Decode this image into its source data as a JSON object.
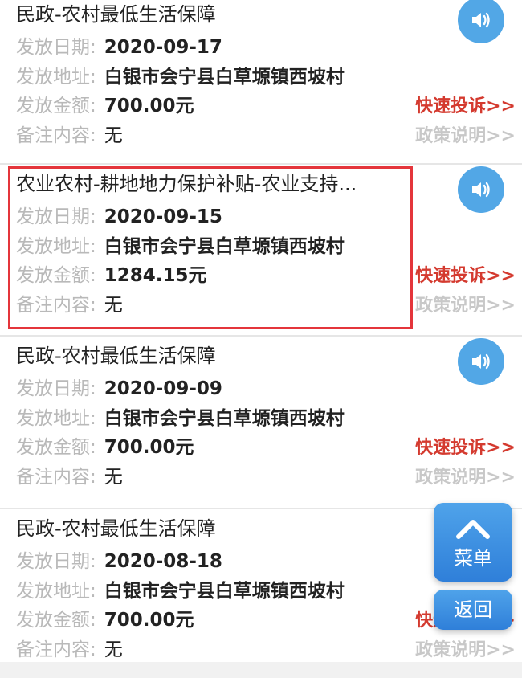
{
  "labels": {
    "date": "发放日期:",
    "address": "发放地址:",
    "amount": "发放金额:",
    "remark": "备注内容:"
  },
  "actions": {
    "complain": "快速投诉>>",
    "policy": "政策说明>>"
  },
  "records": [
    {
      "title": "民政-农村最低生活保障",
      "date": "2020-09-17",
      "address": "白银市会宁县白草塬镇西坡村",
      "amount": "700.00元",
      "remark": "无"
    },
    {
      "title": "农业农村-耕地地力保护补贴-农业支持...",
      "date": "2020-09-15",
      "address": "白银市会宁县白草塬镇西坡村",
      "amount": "1284.15元",
      "remark": "无"
    },
    {
      "title": "民政-农村最低生活保障",
      "date": "2020-09-09",
      "address": "白银市会宁县白草塬镇西坡村",
      "amount": "700.00元",
      "remark": "无"
    },
    {
      "title": "民政-农村最低生活保障",
      "date": "2020-08-18",
      "address": "白银市会宁县白草塬镇西坡村",
      "amount": "700.00元",
      "remark": "无"
    }
  ],
  "floating": {
    "menu_label": "菜单",
    "back_label": "返回"
  },
  "colors": {
    "accent": "#52a7e6",
    "complain": "#d43a2f",
    "highlight_border": "#e4353b"
  }
}
